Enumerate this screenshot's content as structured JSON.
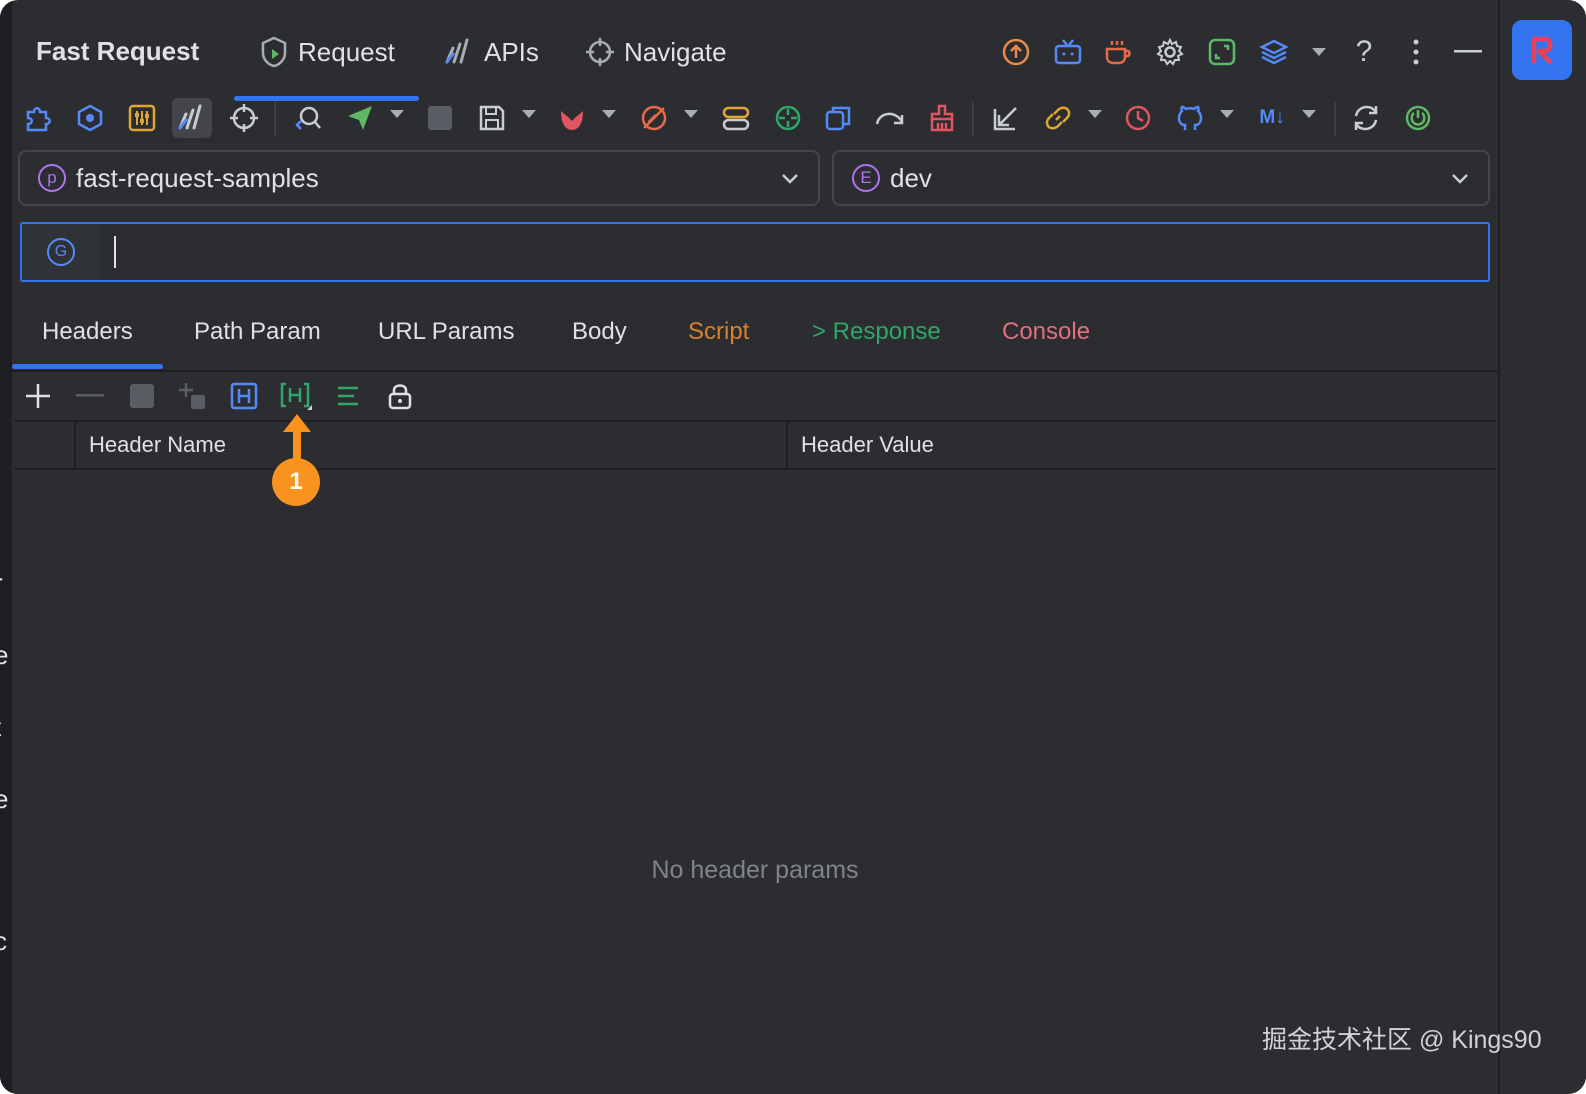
{
  "app": {
    "title": "Fast Request",
    "top_tabs": [
      {
        "label": "Request",
        "active": true
      },
      {
        "label": "APIs",
        "active": false
      },
      {
        "label": "Navigate",
        "active": false
      }
    ]
  },
  "top_icons": [
    "upload-icon",
    "tv-icon",
    "coffee-icon",
    "gear-icon",
    "expand-icon",
    "layers-icon",
    "chevron-down-icon",
    "help-icon",
    "more-vertical-icon",
    "minimize-icon"
  ],
  "toolbar_icons": [
    "puzzle-icon",
    "hexagon-icon",
    "sliders-icon",
    "chart-icon",
    "crosshair-icon",
    "search-code-icon",
    "send-icon",
    "stop-icon",
    "save-icon",
    "bug-icon",
    "no-debug-icon",
    "toggle-icon",
    "target-icon",
    "copy-icon",
    "redo-icon",
    "broom-icon",
    "import-icon",
    "link-icon",
    "history-icon",
    "github-icon",
    "markdown-icon",
    "sync-icon",
    "power-icon"
  ],
  "project_select": {
    "badge": "p",
    "value": "fast-request-samples"
  },
  "env_select": {
    "badge": "E",
    "value": "dev"
  },
  "url_input": {
    "method_badge": "G",
    "value": "",
    "placeholder": ""
  },
  "tabs": [
    {
      "label": "Headers",
      "color": "#dfe1e5",
      "active": true
    },
    {
      "label": "Path Param",
      "color": "#dfe1e5",
      "active": false
    },
    {
      "label": "URL Params",
      "color": "#dfe1e5",
      "active": false
    },
    {
      "label": "Body",
      "color": "#dfe1e5",
      "active": false
    },
    {
      "label": "Script",
      "color": "#d9822b",
      "active": false
    },
    {
      "label": "> Response",
      "color": "#2fa66a",
      "active": false
    },
    {
      "label": "Console",
      "color": "#e0707a",
      "active": false
    }
  ],
  "params_toolbar": [
    "add-icon",
    "remove-icon",
    "stop-icon",
    "add-child-icon",
    "header-icon",
    "global-header-icon",
    "align-icon",
    "lock-icon"
  ],
  "table": {
    "columns": [
      "Header Name",
      "Header Value"
    ],
    "empty_text": "No header params"
  },
  "annotation": {
    "number": "1"
  },
  "watermark": "掘金技术社区 @ Kings90",
  "colors": {
    "accent": "#3574f0",
    "background": "#2b2d30",
    "marker": "#f7931e"
  }
}
